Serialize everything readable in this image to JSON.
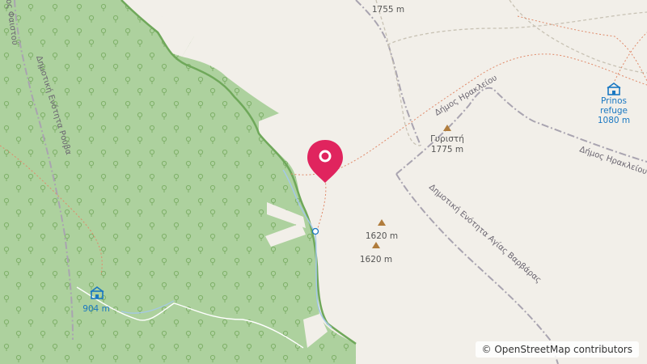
{
  "map": {
    "colors": {
      "land": "#f2efe9",
      "forest": "#add19e",
      "forest_dark": "#8cbf7a",
      "marker": "#e0245e",
      "water": "#a4c8e8",
      "peak": "#b07c3c",
      "refuge": "#1a78c2",
      "admin": "#a9a4b0",
      "path": "#e08a6a",
      "track": "#c8c2b4"
    },
    "labels": {
      "elev_1755": "1755 m",
      "gyristi_name": "Γυριστή",
      "gyristi_elev": "1775 m",
      "peak_a_elev": "1620 m",
      "peak_b_elev": "1620 m",
      "refuge_name_1": "Prinos",
      "refuge_name_2": "refuge",
      "refuge_elev": "1080 m",
      "shelter_elev": "904 m",
      "dimos_irakleiou_1": "Δήμος Ηρακλείου",
      "dimos_irakleiou_2": "Δήμος Ηρακλείου",
      "agias_varvaras": "Δημοτική Ενότητα Αγίας Βαρβάρας",
      "rouvas": "Δημοτική Ενότητα Ρούβα",
      "faistou": "Δήμος Φαιστού"
    },
    "icons": {
      "marker": "map-pin-icon",
      "refuge": "shelter-icon",
      "peak": "peak-triangle-icon"
    }
  },
  "attribution": "© OpenStreetMap contributors"
}
